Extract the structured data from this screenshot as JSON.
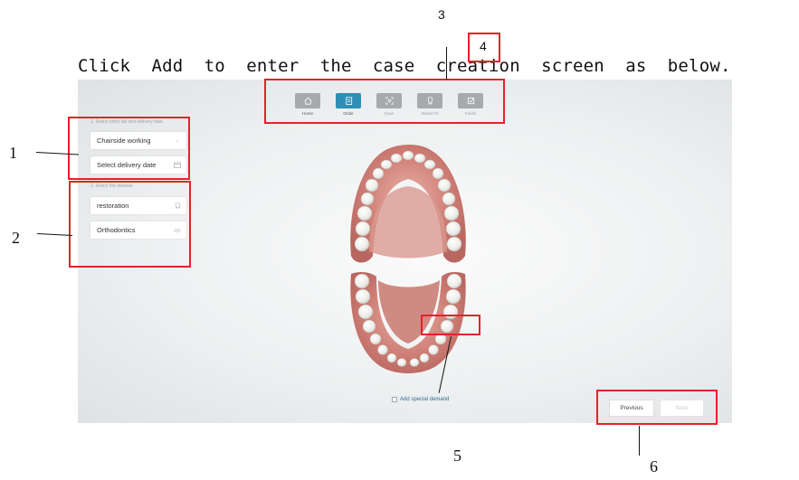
{
  "caption": "Click  Add  to  enter  the  case  creation  screen  as  below.",
  "callouts": {
    "n1": "1",
    "n2": "2",
    "n3": "3",
    "n4": "4",
    "n5": "5",
    "n6": "6"
  },
  "nav": {
    "items": [
      {
        "label": "Home",
        "icon": "home-icon",
        "state": "normal"
      },
      {
        "label": "Order",
        "icon": "order-icon",
        "state": "active"
      },
      {
        "label": "Scan",
        "icon": "scan-icon",
        "state": "disabled"
      },
      {
        "label": "Model Fit",
        "icon": "model-icon",
        "state": "disabled"
      },
      {
        "label": "Finish",
        "icon": "finish-icon",
        "state": "disabled"
      }
    ]
  },
  "sidebar": {
    "section1_hint": "1. Select ortho lab and delivery date",
    "chairside_label": "Chairside working",
    "delivery_label": "Select delivery date",
    "section2_hint": "2. Select the disease",
    "restoration_label": "restoration",
    "orthodontics_label": "Orthodontics"
  },
  "footer": {
    "special_demand": "Add special demand",
    "previous": "Previous",
    "next": "Next"
  },
  "colors": {
    "accent": "#2d8fb6",
    "callout_red": "#e4222a",
    "gum": "#c97a74"
  }
}
